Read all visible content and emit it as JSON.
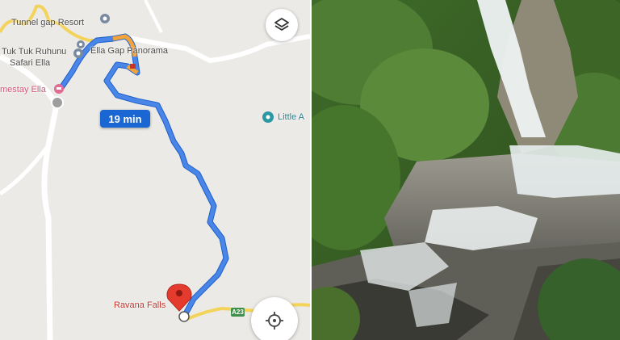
{
  "map": {
    "route_time": "19 min",
    "destination": "Ravana Falls",
    "road_shield": "A23",
    "places": {
      "tunnel_gap": "Tunnel gap Resort",
      "tuk_tuk_1": "Tuk Tuk Ruhunu",
      "tuk_tuk_2": "Safari Ella",
      "ella_gap": "Ella Gap Panorama",
      "homestay": "mestay Ella",
      "little": "Little A"
    },
    "icons": {
      "layers": "layers-icon",
      "locate": "my-location-icon",
      "destination": "map-pin-icon"
    },
    "colors": {
      "route": "#4a86e8",
      "route_traffic": "#f2a33a",
      "destination_pin": "#e53b2f",
      "label_chip": "#1a66d2"
    }
  },
  "photo": {
    "subject": "waterfall"
  }
}
